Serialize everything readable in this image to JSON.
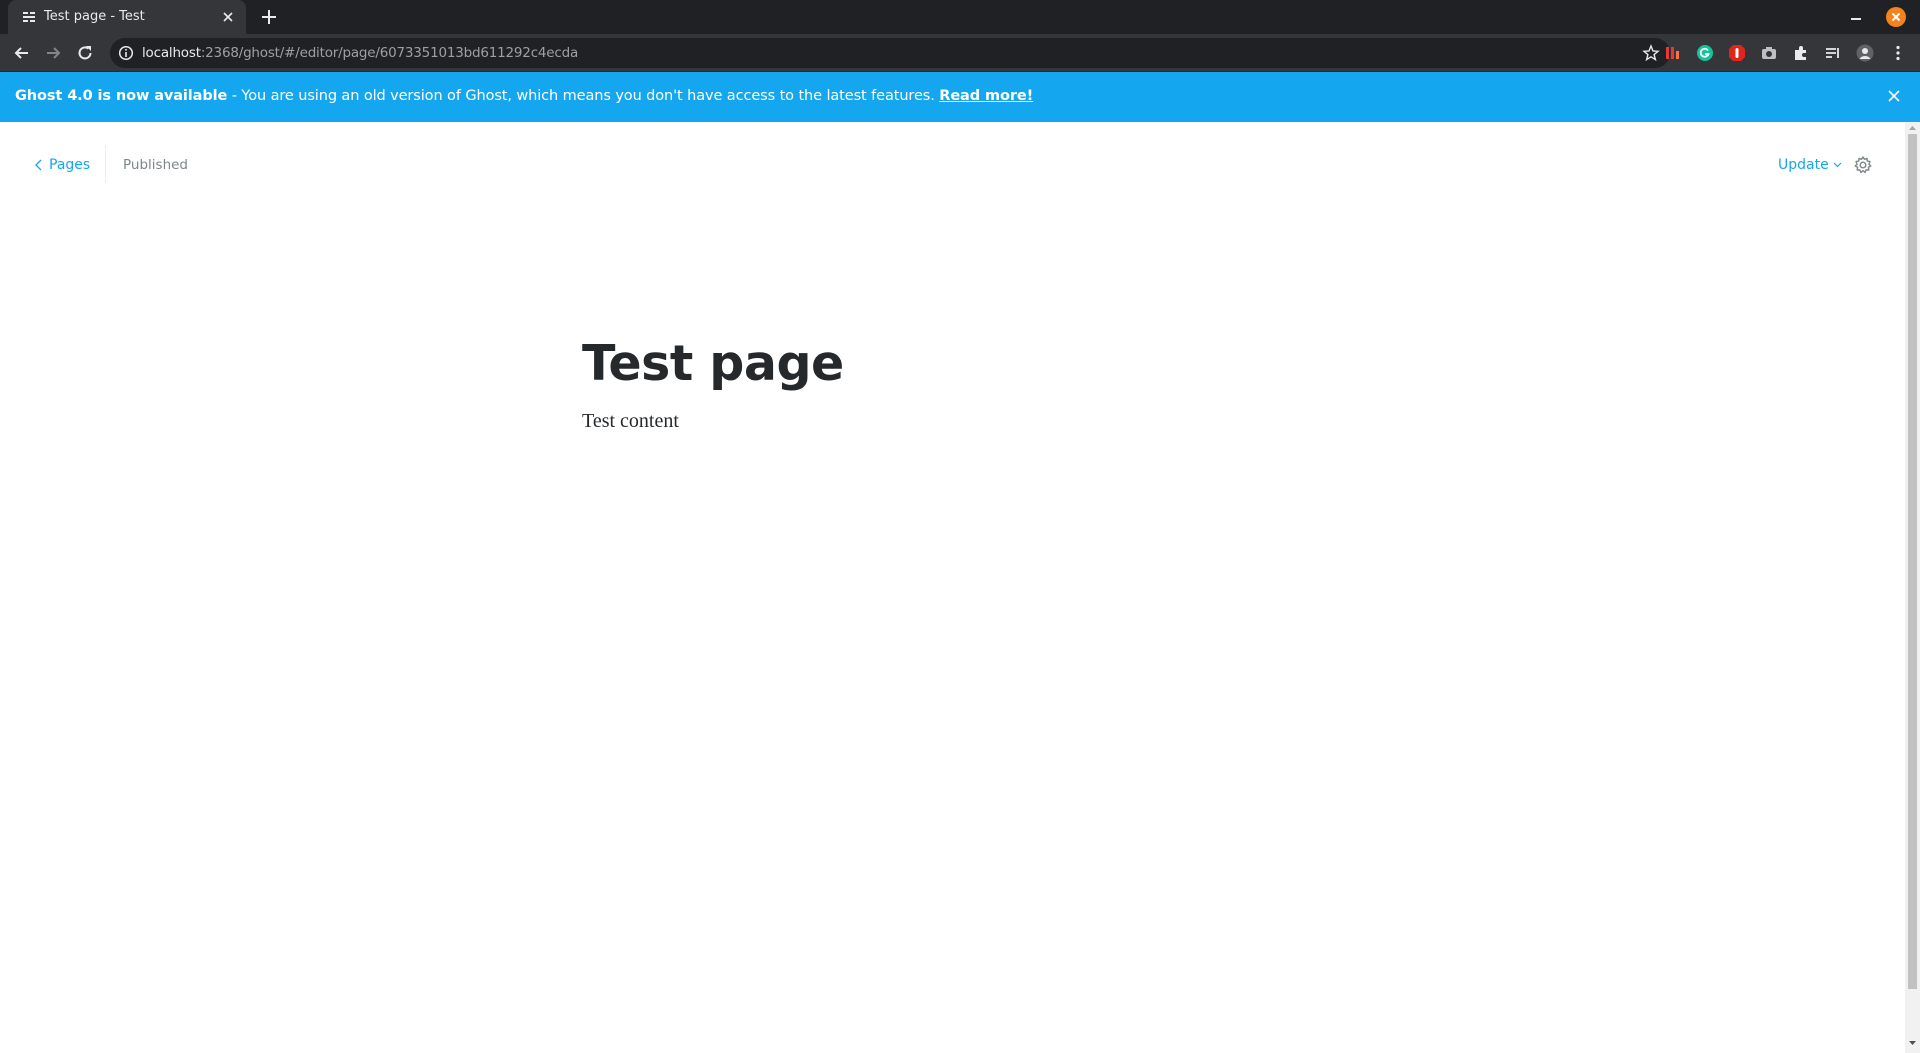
{
  "browser": {
    "tab_title": "Test page - Test",
    "url_host": "localhost",
    "url_path": ":2368/ghost/#/editor/page/6073351013bd611292c4ecda"
  },
  "banner": {
    "bold_text": "Ghost 4.0 is now available",
    "text": " - You are using an old version of Ghost, which means you don't have access to the latest features. ",
    "link": "Read more!"
  },
  "editor": {
    "back_label": "Pages",
    "status": "Published",
    "update_label": "Update",
    "title": "Test page",
    "body": "Test content"
  },
  "colors": {
    "accent": "#14a7ef",
    "banner_bg": "#14a7ef",
    "text_dark": "#26292c",
    "status_gray": "#7d878a"
  }
}
